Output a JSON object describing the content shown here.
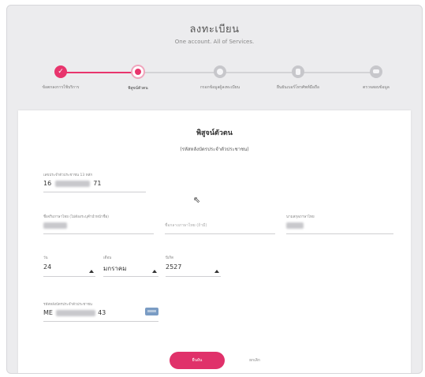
{
  "header": {
    "title": "ลงทะเบียน",
    "subtitle": "One account. All of Services."
  },
  "steps": [
    {
      "label": "ข้อตกลงการใช้บริการ",
      "state": "done"
    },
    {
      "label": "พิสูจน์ตัวตน",
      "state": "current"
    },
    {
      "label": "กรอกข้อมูลผู้ลงทะเบียน",
      "state": "pending"
    },
    {
      "label": "ยืนยันเบอร์โทรศัพท์มือถือ",
      "state": "pending"
    },
    {
      "label": "ตรวจสอบข้อมูล",
      "state": "pending"
    }
  ],
  "form": {
    "title": "พิสูจน์ตัวตน",
    "subtitle": "(รหัสหลังบัตรประจำตัวประชาชน)",
    "id_number": {
      "label": "เลขประจำตัวประชาชน 13 หลัก",
      "prefix": "16",
      "suffix": "71"
    },
    "first_name": {
      "label": "ชื่อจริงภาษาไทย (ไม่ต้องระบุคำนำหน้าชื่อ)"
    },
    "middle_name": {
      "placeholder": "ชื่อกลางภาษาไทย (ถ้ามี)"
    },
    "last_name": {
      "label": "นามสกุลภาษาไทย"
    },
    "birth_day": {
      "label": "วัน",
      "value": "24"
    },
    "birth_month": {
      "label": "เดือน",
      "value": "มกราคม"
    },
    "birth_year": {
      "label": "ปีเกิด",
      "value": "2527"
    },
    "laser_code": {
      "label": "รหัสหลังบัตรประจำตัวประชาชน",
      "prefix": "ME",
      "suffix": "43"
    },
    "confirm_label": "ยืนยัน",
    "cancel_label": "ยกเลิก"
  },
  "colors": {
    "accent": "#e0316a",
    "step_pending": "#c7c7cb",
    "background": "#ececee"
  },
  "icons": {
    "done": "check-icon",
    "pending": "form-icon",
    "cursor": "mouse-pointer-icon"
  }
}
